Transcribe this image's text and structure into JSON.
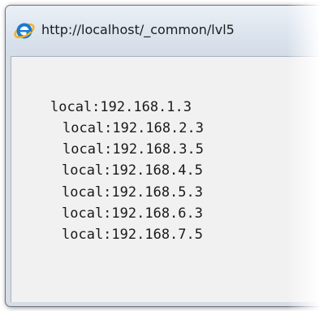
{
  "window": {
    "title": "http://localhost/_common/lvl5"
  },
  "content": {
    "lines": [
      "local:192.168.1.3",
      "local:192.168.2.3",
      "local:192.168.3.5",
      "local:192.168.4.5",
      "local:192.168.5.3",
      "local:192.168.6.3",
      "local:192.168.7.5"
    ]
  },
  "icons": {
    "browser": "ie-icon"
  },
  "colors": {
    "titlebar": "#dce4ee",
    "client_bg": "#f1f1f1",
    "ie_blue": "#1a7ad4",
    "ie_ring": "#f2b51d"
  }
}
